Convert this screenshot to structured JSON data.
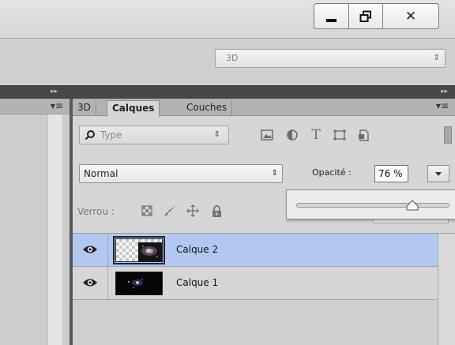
{
  "window_controls": {
    "minimize_icon": "minimize-icon",
    "restore_icon": "restore-icon",
    "close_icon": "close-icon",
    "close_label": "✕"
  },
  "options_bar": {
    "mode_select_value": "3D"
  },
  "tabs": [
    {
      "label": "3D",
      "active": false
    },
    {
      "label": "Calques",
      "active": true
    },
    {
      "label": "Couches",
      "active": false
    }
  ],
  "filter": {
    "kind_value": "Type",
    "icons": [
      "image-filter-icon",
      "adjustment-filter-icon",
      "text-filter-icon",
      "shape-filter-icon",
      "smart-object-filter-icon"
    ],
    "text_glyph": "T"
  },
  "blend": {
    "mode_value": "Normal",
    "opacity_label": "Opacité :",
    "opacity_value": "76 %",
    "opacity_fraction": 0.76
  },
  "lock": {
    "label": "Verrou :",
    "icons": [
      "lock-transparent-pixels-icon",
      "lock-image-pixels-icon",
      "lock-position-icon",
      "lock-all-icon"
    ]
  },
  "layers": [
    {
      "name": "Calque 2",
      "selected": true,
      "visible": true
    },
    {
      "name": "Calque 1",
      "selected": false,
      "visible": true
    }
  ],
  "colors": {
    "selection": "#b3c8f0",
    "dock": "#474747"
  }
}
